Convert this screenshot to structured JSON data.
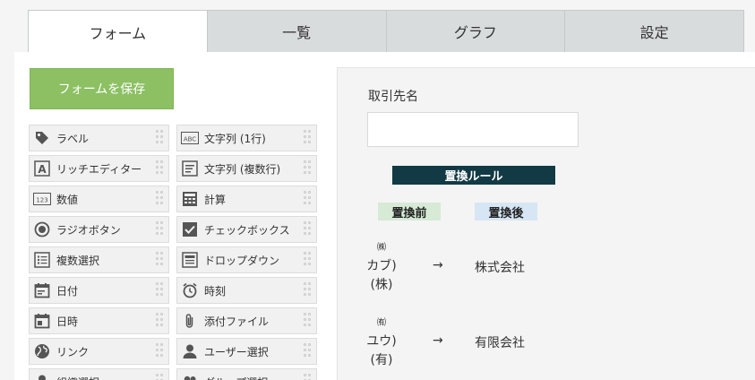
{
  "tabs": [
    "フォーム",
    "一覧",
    "グラフ",
    "設定"
  ],
  "active_tab": 0,
  "save_button": "フォームを保存",
  "palette": [
    {
      "label": "ラベル",
      "icon": "tag-icon"
    },
    {
      "label": "文字列 (1行)",
      "icon": "abc-icon"
    },
    {
      "label": "リッチエディター",
      "icon": "rich-editor-icon"
    },
    {
      "label": "文字列 (複数行)",
      "icon": "multiline-text-icon"
    },
    {
      "label": "数値",
      "icon": "number-icon"
    },
    {
      "label": "計算",
      "icon": "calculator-icon"
    },
    {
      "label": "ラジオボタン",
      "icon": "radio-icon"
    },
    {
      "label": "チェックボックス",
      "icon": "checkbox-icon"
    },
    {
      "label": "複数選択",
      "icon": "multi-select-icon"
    },
    {
      "label": "ドロップダウン",
      "icon": "dropdown-icon"
    },
    {
      "label": "日付",
      "icon": "date-icon"
    },
    {
      "label": "時刻",
      "icon": "clock-icon"
    },
    {
      "label": "日時",
      "icon": "datetime-icon"
    },
    {
      "label": "添付ファイル",
      "icon": "attachment-icon"
    },
    {
      "label": "リンク",
      "icon": "globe-icon"
    },
    {
      "label": "ユーザー選択",
      "icon": "user-icon"
    },
    {
      "label": "組織選択",
      "icon": "org-icon"
    },
    {
      "label": "グループ選択",
      "icon": "group-icon"
    }
  ],
  "form": {
    "field_label": "取引先名",
    "field_value": "",
    "rule_title": "置換ルール",
    "before_header": "置換前",
    "after_header": "置換後",
    "rules": [
      {
        "before_lines": [
          "㈱",
          "カブ)",
          "(株)"
        ],
        "arrow": "→",
        "after": "株式会社"
      },
      {
        "before_lines": [
          "㈲",
          "ユウ)",
          "(有)"
        ],
        "arrow": "→",
        "after": "有限会社"
      }
    ]
  },
  "colors": {
    "save_green": "#8cc063",
    "rule_title_bg": "#123a44",
    "before_bg": "#d6ead6",
    "after_bg": "#d6e6f4"
  }
}
